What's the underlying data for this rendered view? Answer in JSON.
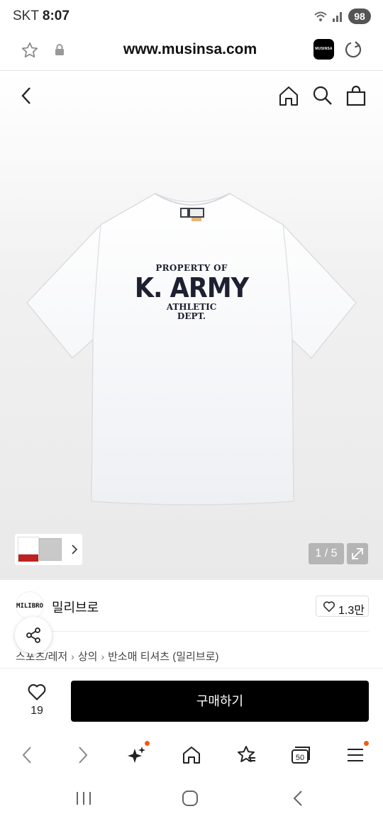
{
  "status_bar": {
    "carrier": "SKT",
    "time": "8:07",
    "battery": "98"
  },
  "browser": {
    "url": "www.musinsa.com",
    "app_badge": "MUSINSA"
  },
  "product": {
    "print_top": "PROPERTY OF",
    "print_main": "K. ARMY",
    "print_sub1": "ATHLETIC",
    "print_sub2": "DEPT.",
    "page_counter": "1 / 5"
  },
  "brand": {
    "logo_text": "MILIBRO",
    "name": "밀리브로",
    "like_count": "1.3만"
  },
  "breadcrumb": [
    "스포츠/레저",
    "상의",
    "반소매 티셔츠 (밀리브로)"
  ],
  "purchase": {
    "wish_count": "19",
    "buy_label": "구매하기"
  },
  "browser_nav": {
    "tabs_count": "50"
  },
  "colors": {
    "notification_dot": "#f05a1a",
    "buy_button": "#000000"
  }
}
